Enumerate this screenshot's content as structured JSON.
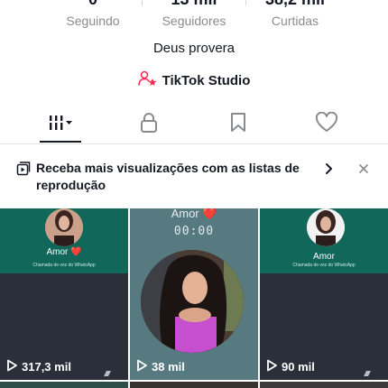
{
  "profile": {
    "stats": [
      {
        "value": "0",
        "label": "Seguindo"
      },
      {
        "value": "13 mil",
        "label": "Seguidores"
      },
      {
        "value": "38,2 mil",
        "label": "Curtidas"
      }
    ],
    "bio": "Deus provera",
    "studio_label": "TikTok Studio"
  },
  "tabs": [
    {
      "icon": "videos-grid-icon",
      "active": true
    },
    {
      "icon": "lock-icon",
      "active": false
    },
    {
      "icon": "bookmark-icon",
      "active": false
    },
    {
      "icon": "heart-icon",
      "active": false
    }
  ],
  "banner": {
    "icon": "playlist-icon",
    "text": "Receba mais visualizações com as listas de reprodução"
  },
  "videos": [
    {
      "views": "317,3 mil",
      "caption": "Amor ❤️",
      "subcaption": "Chamada de voz do WhatsApp"
    },
    {
      "views": "38 mil",
      "caption": "Amor ❤️",
      "timer": "00:00"
    },
    {
      "views": "90 mil",
      "caption": "Amor",
      "subcaption": "Chamada de voz do WhatsApp"
    }
  ],
  "colors": {
    "text": "#161823",
    "secondary": "#8a8b91",
    "studio_accent": "#fe2c55",
    "teal": "#10675a"
  }
}
